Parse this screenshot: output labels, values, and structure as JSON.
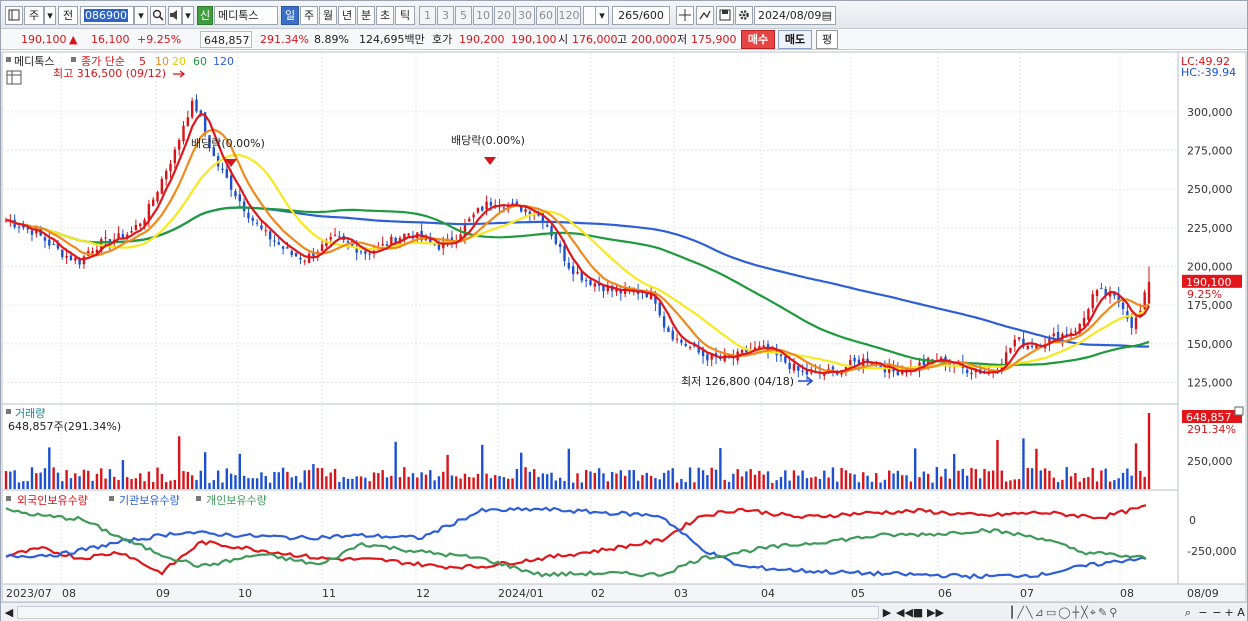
{
  "toolbar": {
    "period_week_label": "주",
    "prev_label": "전",
    "stock_code": "086900",
    "market_badge": "신",
    "stock_name": "메디톡스",
    "intervals": [
      "일",
      "주",
      "월",
      "년",
      "분",
      "초",
      "틱"
    ],
    "selected_interval": "일",
    "numbers": [
      "1",
      "3",
      "5",
      "10",
      "20",
      "30",
      "60",
      "120"
    ],
    "count_display": "265/600",
    "date_value": "2024/08/09"
  },
  "quote": {
    "price": "190,100",
    "change_arrow": "▲",
    "change": "16,100",
    "change_pct": "+9.25%",
    "volume": "648,857",
    "volume_ratio": "291.34%",
    "turnover": "8.89%",
    "amount": "124,695백만",
    "hoga_label": "호가",
    "ask": "190,200",
    "bid": "190,100",
    "open_label": "시",
    "open": "176,000",
    "high_label": "고",
    "high": "200,000",
    "low_label": "저",
    "low": "175,900",
    "buy_label": "매수",
    "sell_label": "매도",
    "avg_label": "평"
  },
  "price_panel": {
    "legend_name": "메디톡스",
    "legend_series": "종가 단순",
    "ma_periods": [
      "5",
      "10",
      "20",
      "60",
      "120"
    ],
    "high_note": "최고 316,500 (09/12)",
    "low_note": "최저 126,800 (04/18)",
    "dividend_1": "배당락(0.00%)",
    "dividend_2": "배당락(0.00%)",
    "lc_label": "LC:49.92",
    "hc_label": "HC:-39.94",
    "last_price_tag": "190,100",
    "last_pct_tag": "9.25%"
  },
  "volume_panel": {
    "title": "거래량",
    "value_text": "648,857주(291.34%)",
    "last_tag": "648,857",
    "last_pct_tag": "291.34%",
    "axis_tick": "250,000"
  },
  "holdings_panel": {
    "legend": [
      "외국인보유수량",
      "기관보유수량",
      "개인보유수량"
    ],
    "axis_ticks": [
      "0",
      "-250,000"
    ]
  },
  "x_axis": {
    "labels": [
      "2023/07",
      "08",
      "09",
      "10",
      "11",
      "12",
      "2024/01",
      "02",
      "03",
      "04",
      "05",
      "06",
      "07",
      "08",
      "08/09"
    ]
  },
  "colors": {
    "up": "#d7141a",
    "down": "#1d4fd1",
    "ma5": "#e0161b",
    "ma10": "#f08a1c",
    "ma20": "#f7e81f",
    "ma60": "#1e9a3c",
    "ma120": "#2f5fd6",
    "foreign": "#e0161b",
    "institution": "#2f5fd6",
    "individual": "#3f9a5a"
  },
  "chart_data": [
    {
      "type": "candlestick",
      "title": "메디톡스",
      "series_label": "종가 단순",
      "moving_averages": [
        "5",
        "10",
        "20",
        "60",
        "120"
      ],
      "x_labels": [
        "2023/07",
        "08",
        "09",
        "10",
        "11",
        "12",
        "2024/01",
        "02",
        "03",
        "04",
        "05",
        "06",
        "07",
        "08",
        "08/09"
      ],
      "y_ticks": [
        125000,
        150000,
        175000,
        200000,
        225000,
        250000,
        275000,
        300000
      ],
      "ylim": [
        113000,
        320000
      ],
      "close_path": [
        [
          0,
          230000
        ],
        [
          12,
          227000
        ],
        [
          30,
          222000
        ],
        [
          45,
          214000
        ],
        [
          60,
          207000
        ],
        [
          75,
          203000
        ],
        [
          82,
          210000
        ],
        [
          95,
          215000
        ],
        [
          110,
          218000
        ],
        [
          125,
          222000
        ],
        [
          140,
          233000
        ],
        [
          150,
          247000
        ],
        [
          160,
          262000
        ],
        [
          170,
          275000
        ],
        [
          178,
          292000
        ],
        [
          186,
          305000
        ],
        [
          194,
          300000
        ],
        [
          200,
          285000
        ],
        [
          210,
          268000
        ],
        [
          220,
          258000
        ],
        [
          232,
          245000
        ],
        [
          245,
          232000
        ],
        [
          258,
          222000
        ],
        [
          272,
          215000
        ],
        [
          285,
          208000
        ],
        [
          300,
          205000
        ],
        [
          315,
          212000
        ],
        [
          330,
          218000
        ],
        [
          345,
          214000
        ],
        [
          360,
          209000
        ],
        [
          375,
          212000
        ],
        [
          390,
          218000
        ],
        [
          405,
          222000
        ],
        [
          420,
          216000
        ],
        [
          435,
          213000
        ],
        [
          450,
          218000
        ],
        [
          462,
          228000
        ],
        [
          472,
          235000
        ],
        [
          482,
          240000
        ],
        [
          492,
          243000
        ],
        [
          502,
          240000
        ],
        [
          515,
          238000
        ],
        [
          528,
          236000
        ],
        [
          540,
          230000
        ],
        [
          552,
          215000
        ],
        [
          565,
          200000
        ],
        [
          580,
          192000
        ],
        [
          595,
          188000
        ],
        [
          610,
          184000
        ],
        [
          625,
          183000
        ],
        [
          640,
          184000
        ],
        [
          652,
          178000
        ],
        [
          660,
          162000
        ],
        [
          672,
          153000
        ],
        [
          685,
          148000
        ],
        [
          700,
          142000
        ],
        [
          715,
          140000
        ],
        [
          730,
          141000
        ],
        [
          745,
          146000
        ],
        [
          758,
          147000
        ],
        [
          770,
          143000
        ],
        [
          782,
          138000
        ],
        [
          795,
          132000
        ],
        [
          808,
          130000
        ],
        [
          822,
          131000
        ],
        [
          835,
          133000
        ],
        [
          848,
          137000
        ],
        [
          862,
          140000
        ],
        [
          876,
          136000
        ],
        [
          890,
          132000
        ],
        [
          905,
          134000
        ],
        [
          918,
          137000
        ],
        [
          932,
          140000
        ],
        [
          945,
          138000
        ],
        [
          958,
          134000
        ],
        [
          972,
          133000
        ],
        [
          986,
          131000
        ],
        [
          1000,
          140000
        ],
        [
          1012,
          153000
        ],
        [
          1025,
          149000
        ],
        [
          1038,
          151000
        ],
        [
          1052,
          155000
        ],
        [
          1065,
          157000
        ],
        [
          1078,
          162000
        ],
        [
          1090,
          182000
        ],
        [
          1100,
          183000
        ],
        [
          1110,
          180000
        ],
        [
          1120,
          175000
        ],
        [
          1128,
          162000
        ],
        [
          1136,
          168000
        ],
        [
          1146,
          190100
        ]
      ],
      "last": {
        "open": 176000,
        "high": 200000,
        "low": 175900,
        "close": 190100
      },
      "high_marker": {
        "value": 316500,
        "date": "09/12"
      },
      "low_marker": {
        "value": 126800,
        "date": "04/18"
      }
    },
    {
      "type": "bar",
      "title": "거래량",
      "y_ticks": [
        250000
      ],
      "last_value": 648857
    },
    {
      "type": "line",
      "series": [
        {
          "name": "외국인보유수량"
        },
        {
          "name": "기관보유수량"
        },
        {
          "name": "개인보유수량"
        }
      ],
      "y_ticks": [
        0,
        -250000
      ]
    }
  ]
}
